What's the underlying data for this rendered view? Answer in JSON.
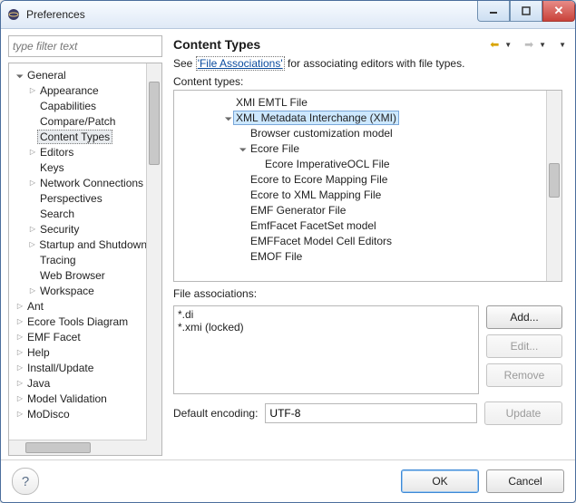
{
  "window": {
    "title": "Preferences"
  },
  "sidebar": {
    "filter_placeholder": "type filter text",
    "items": [
      {
        "label": "General",
        "depth": 0,
        "expand": "exp"
      },
      {
        "label": "Appearance",
        "depth": 1,
        "expand": "col"
      },
      {
        "label": "Capabilities",
        "depth": 1,
        "expand": ""
      },
      {
        "label": "Compare/Patch",
        "depth": 1,
        "expand": ""
      },
      {
        "label": "Content Types",
        "depth": 1,
        "expand": "",
        "selected": true
      },
      {
        "label": "Editors",
        "depth": 1,
        "expand": "col"
      },
      {
        "label": "Keys",
        "depth": 1,
        "expand": ""
      },
      {
        "label": "Network Connections",
        "depth": 1,
        "expand": "col"
      },
      {
        "label": "Perspectives",
        "depth": 1,
        "expand": ""
      },
      {
        "label": "Search",
        "depth": 1,
        "expand": ""
      },
      {
        "label": "Security",
        "depth": 1,
        "expand": "col"
      },
      {
        "label": "Startup and Shutdown",
        "depth": 1,
        "expand": "col"
      },
      {
        "label": "Tracing",
        "depth": 1,
        "expand": ""
      },
      {
        "label": "Web Browser",
        "depth": 1,
        "expand": ""
      },
      {
        "label": "Workspace",
        "depth": 1,
        "expand": "col"
      },
      {
        "label": "Ant",
        "depth": 0,
        "expand": "col"
      },
      {
        "label": "Ecore Tools Diagram",
        "depth": 0,
        "expand": "col"
      },
      {
        "label": "EMF Facet",
        "depth": 0,
        "expand": "col"
      },
      {
        "label": "Help",
        "depth": 0,
        "expand": "col"
      },
      {
        "label": "Install/Update",
        "depth": 0,
        "expand": "col"
      },
      {
        "label": "Java",
        "depth": 0,
        "expand": "col"
      },
      {
        "label": "Model Validation",
        "depth": 0,
        "expand": "col"
      },
      {
        "label": "MoDisco",
        "depth": 0,
        "expand": "col"
      }
    ]
  },
  "content": {
    "heading": "Content Types",
    "desc_prefix": "See ",
    "desc_link": "'File Associations'",
    "desc_suffix": " for associating editors with file types.",
    "content_types_label": "Content types:",
    "ct_items": [
      {
        "label": "XMI EMTL File",
        "depth": 3,
        "expand": ""
      },
      {
        "label": "XML Metadata Interchange (XMI)",
        "depth": 3,
        "expand": "exp",
        "selected": true
      },
      {
        "label": "Browser customization model",
        "depth": 4,
        "expand": ""
      },
      {
        "label": "Ecore File",
        "depth": 4,
        "expand": "exp"
      },
      {
        "label": "Ecore ImperativeOCL File",
        "depth": 5,
        "expand": ""
      },
      {
        "label": "Ecore to Ecore Mapping File",
        "depth": 4,
        "expand": ""
      },
      {
        "label": "Ecore to XML Mapping File",
        "depth": 4,
        "expand": ""
      },
      {
        "label": "EMF Generator File",
        "depth": 4,
        "expand": ""
      },
      {
        "label": "EmfFacet FacetSet model",
        "depth": 4,
        "expand": ""
      },
      {
        "label": "EMFFacet Model Cell Editors",
        "depth": 4,
        "expand": ""
      },
      {
        "label": "EMOF File",
        "depth": 4,
        "expand": ""
      }
    ],
    "file_assoc_label": "File associations:",
    "file_assoc": [
      "*.di",
      "*.xmi (locked)"
    ],
    "buttons": {
      "add": "Add...",
      "edit": "Edit...",
      "remove": "Remove",
      "update": "Update"
    },
    "encoding_label": "Default encoding:",
    "encoding_value": "UTF-8"
  },
  "dialog": {
    "ok": "OK",
    "cancel": "Cancel"
  }
}
